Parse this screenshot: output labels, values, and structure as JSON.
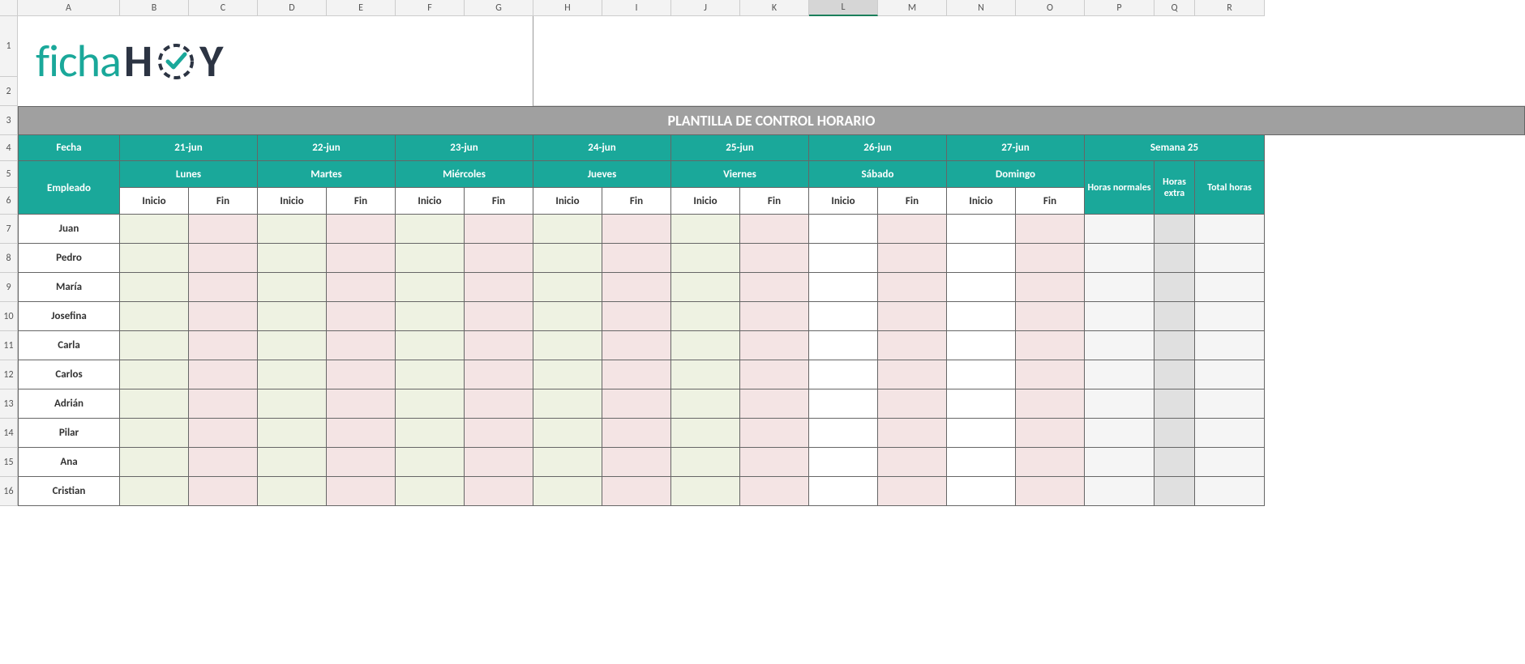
{
  "columns": [
    "A",
    "B",
    "C",
    "D",
    "E",
    "F",
    "G",
    "H",
    "I",
    "J",
    "K",
    "L",
    "M",
    "N",
    "O",
    "P",
    "Q",
    "R"
  ],
  "selected_column": "L",
  "rows": [
    "1",
    "2",
    "3",
    "4",
    "5",
    "6",
    "7",
    "8",
    "9",
    "10",
    "11",
    "12",
    "13",
    "14",
    "15",
    "16"
  ],
  "logo": {
    "part1": "ficha",
    "part2": "H",
    "part3": "Y"
  },
  "title": "PLANTILLA DE CONTROL HORARIO",
  "header": {
    "fecha": "Fecha",
    "empleado": "Empleado",
    "dates": [
      "21-jun",
      "22-jun",
      "23-jun",
      "24-jun",
      "25-jun",
      "26-jun",
      "27-jun"
    ],
    "days": [
      "Lunes",
      "Martes",
      "Miércoles",
      "Jueves",
      "Viernes",
      "Sábado",
      "Domingo"
    ],
    "inicio": "Inicio",
    "fin": "Fin",
    "semana": "Semana 25",
    "horas_normales": "Horas normales",
    "horas_extra": "Horas extra",
    "total_horas": "Total horas"
  },
  "employees": [
    "Juan",
    "Pedro",
    "María",
    "Josefina",
    "Carla",
    "Carlos",
    "Adrián",
    "Pilar",
    "Ana",
    "Cristian"
  ]
}
